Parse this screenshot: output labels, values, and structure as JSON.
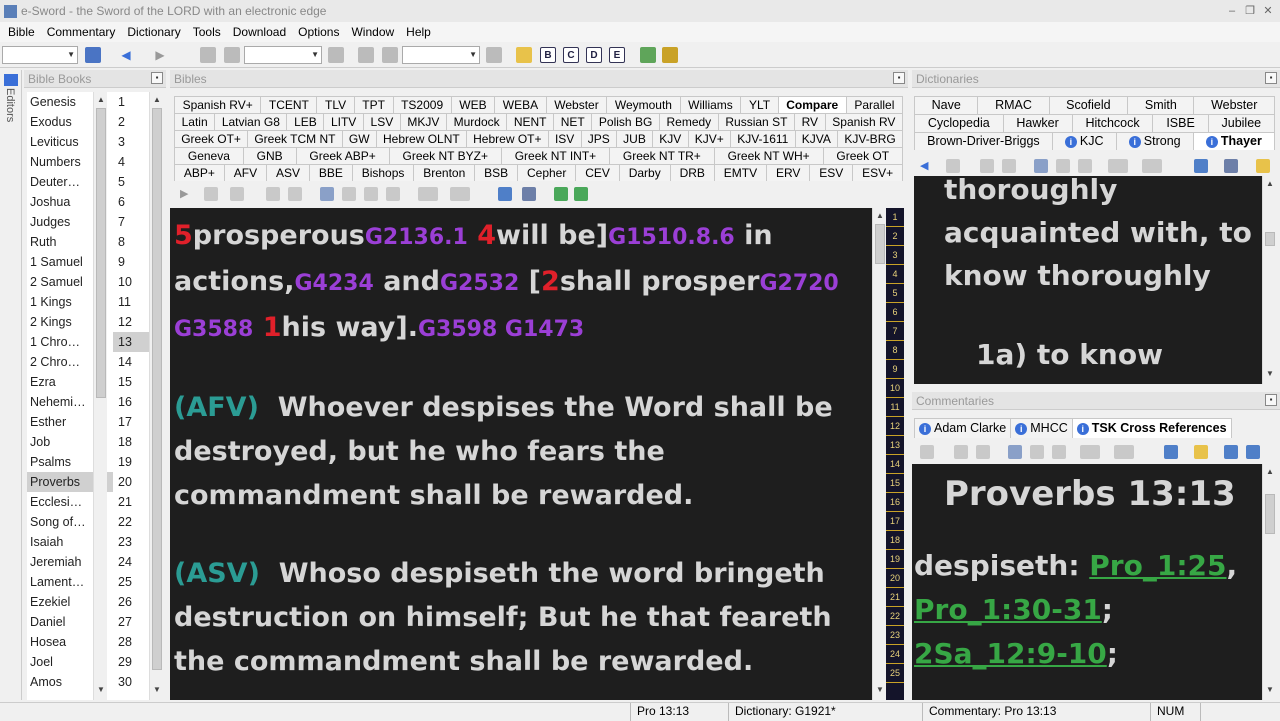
{
  "window": {
    "title": "e-Sword - the Sword of the LORD with an electronic edge"
  },
  "menu": [
    "Bible",
    "Commentary",
    "Dictionary",
    "Tools",
    "Download",
    "Options",
    "Window",
    "Help"
  ],
  "editors_label": "Editors",
  "books_pane": {
    "title": "Bible Books",
    "books": [
      "Genesis",
      "Exodus",
      "Leviticus",
      "Numbers",
      "Deuter…",
      "Joshua",
      "Judges",
      "Ruth",
      "1 Samuel",
      "2 Samuel",
      "1 Kings",
      "2 Kings",
      "1 Chro…",
      "2 Chro…",
      "Ezra",
      "Nehemi…",
      "Esther",
      "Job",
      "Psalms",
      "Proverbs",
      "Ecclesi…",
      "Song of…",
      "Isaiah",
      "Jeremiah",
      "Lament…",
      "Ezekiel",
      "Daniel",
      "Hosea",
      "Joel",
      "Amos"
    ],
    "selected_book": "Proverbs",
    "chapters": [
      "1",
      "2",
      "3",
      "4",
      "5",
      "6",
      "7",
      "8",
      "9",
      "10",
      "11",
      "12",
      "13",
      "14",
      "15",
      "16",
      "17",
      "18",
      "19",
      "20",
      "21",
      "22",
      "23",
      "24",
      "25",
      "26",
      "27",
      "28",
      "29",
      "30"
    ],
    "selected_chapter": "13"
  },
  "bibles_pane": {
    "title": "Bibles",
    "tab_rows": [
      [
        "Spanish RV+",
        "TCENT",
        "TLV",
        "TPT",
        "TS2009",
        "WEB",
        "WEBA",
        "Webster",
        "Weymouth",
        "Williams",
        "YLT",
        "Compare",
        "Parallel"
      ],
      [
        "Latin",
        "Latvian G8",
        "LEB",
        "LITV",
        "LSV",
        "MKJV",
        "Murdock",
        "NENT",
        "NET",
        "Polish BG",
        "Remedy",
        "Russian ST",
        "RV",
        "Spanish RV"
      ],
      [
        "Greek OT+",
        "Greek TCM NT",
        "GW",
        "Hebrew OLNT",
        "Hebrew OT+",
        "ISV",
        "JPS",
        "JUB",
        "KJV",
        "KJV+",
        "KJV-1611",
        "KJVA",
        "KJV-BRG"
      ],
      [
        "Geneva",
        "GNB",
        "Greek ABP+",
        "Greek NT BYZ+",
        "Greek NT INT+",
        "Greek NT TR+",
        "Greek NT WH+",
        "Greek OT"
      ],
      [
        "ABP+",
        "AFV",
        "ASV",
        "BBE",
        "Bishops",
        "Brenton",
        "BSB",
        "Cepher",
        "CEV",
        "Darby",
        "DRB",
        "EMTV",
        "ERV",
        "ESV",
        "ESV+"
      ]
    ],
    "selected_tab": "Compare",
    "text": {
      "abp_n1": "5",
      "abp_w1": "prosperous",
      "abp_s1": "G2136.1",
      "abp_n2": "4",
      "abp_w2": "will be]",
      "abp_s2": "G1510.8.6",
      "abp_w3": " in",
      "abp_w4": "actions,",
      "abp_s3": "G4234",
      "abp_w5": " and",
      "abp_s4": "G2532",
      "abp_w6": " [",
      "abp_n3": "2",
      "abp_w7": "shall prosper",
      "abp_s5": "G2720",
      "abp_s6": "G3588",
      "abp_n4": "1",
      "abp_w8": "his way].",
      "abp_s7": "G3598 G1473",
      "afv_label": "(AFV)",
      "afv_text": "Whoever despises the Word shall be destroyed, but he who fears the commandment shall be rewarded.",
      "asv_label": "(ASV)",
      "asv_text": "Whoso despiseth the word bringeth destruction on himself; But he that feareth the commandment shall be rewarded."
    },
    "strip_markers": [
      "1",
      "2",
      "3",
      "4",
      "5",
      "6",
      "7",
      "8",
      "9",
      "10",
      "11",
      "12",
      "13",
      "14",
      "15",
      "16",
      "17",
      "18",
      "19",
      "20",
      "21",
      "22",
      "23",
      "24",
      "25"
    ]
  },
  "dictionaries_pane": {
    "title": "Dictionaries",
    "tab_rows": [
      [
        "Nave",
        "RMAC",
        "Scofield",
        "Smith",
        "Webster"
      ],
      [
        "Cyclopedia",
        "Hawker",
        "Hitchcock",
        "ISBE",
        "Jubilee"
      ],
      [
        "Brown-Driver-Briggs",
        "KJC",
        "Strong",
        "Thayer"
      ]
    ],
    "selected_tab": "Thayer",
    "lines": [
      "thoroughly",
      "acquainted with, to",
      "know thoroughly",
      "",
      "1a) to know"
    ]
  },
  "commentaries_pane": {
    "title": "Commentaries",
    "tabs": [
      "Adam Clarke",
      "MHCC",
      "TSK Cross References"
    ],
    "selected_tab": "TSK Cross References",
    "heading": "Proverbs 13:13",
    "word": "despiseth:",
    "refs": [
      "Pro_1:25",
      "Pro_1:30-31",
      "2Sa_12:9-10"
    ]
  },
  "status": {
    "verse": "Pro 13:13",
    "dictionary": "Dictionary: G1921*",
    "commentary": "Commentary: Pro 13:13",
    "num": "NUM"
  },
  "colors": {
    "red_number": "#e0202a",
    "strong_purple": "#9b3fd6",
    "version_teal": "#2b9c94",
    "link_green": "#37a745",
    "pane_bg": "#1e1e1e"
  }
}
